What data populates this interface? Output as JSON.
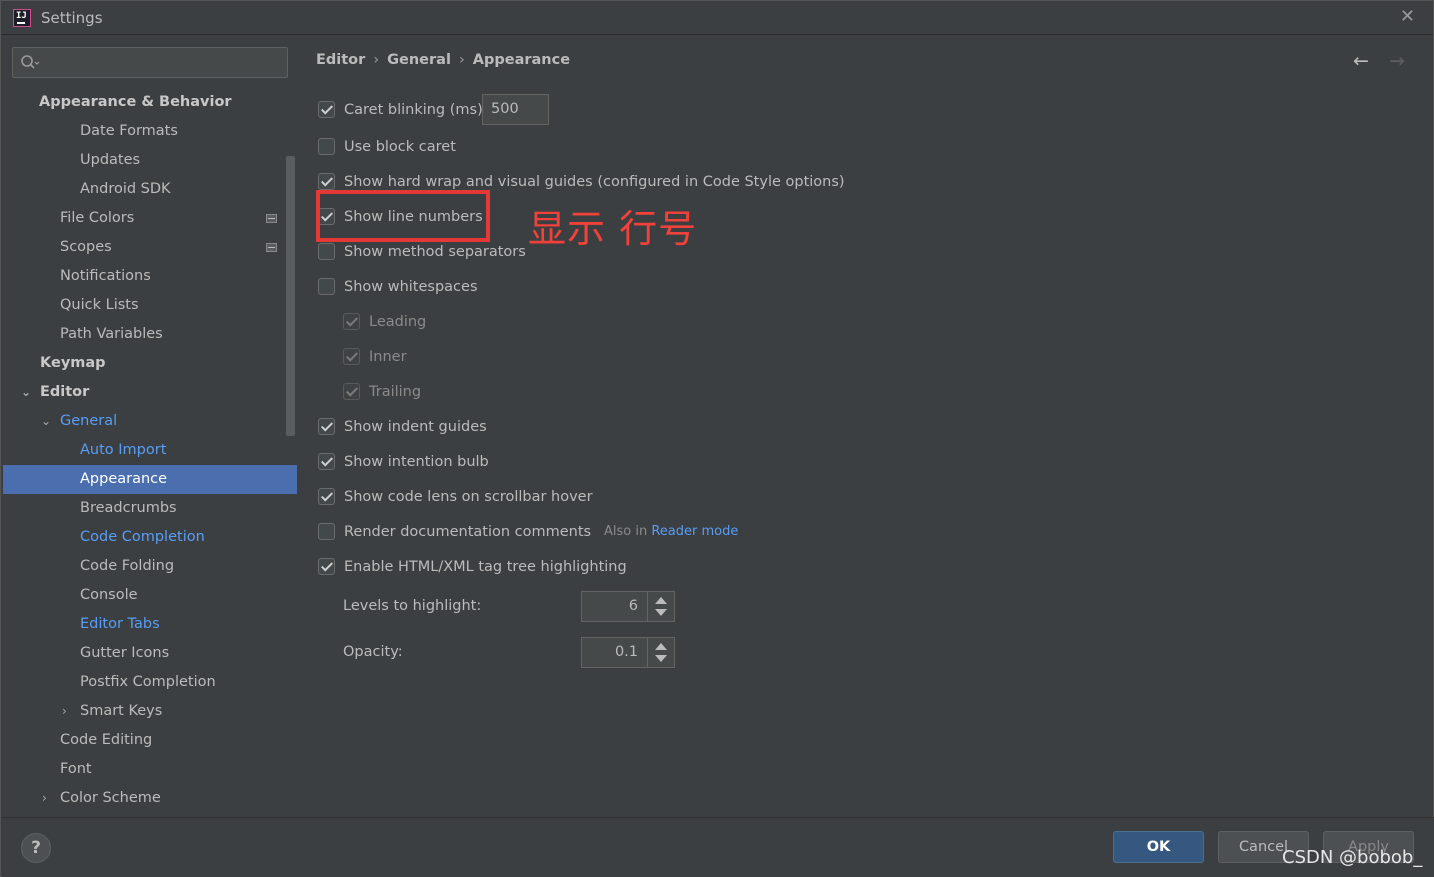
{
  "window": {
    "title": "Settings"
  },
  "search": {
    "placeholder": ""
  },
  "sidebar": {
    "items": [
      {
        "label": "Appearance & Behavior"
      },
      {
        "label": "Date Formats"
      },
      {
        "label": "Updates"
      },
      {
        "label": "Android SDK"
      },
      {
        "label": "File Colors"
      },
      {
        "label": "Scopes"
      },
      {
        "label": "Notifications"
      },
      {
        "label": "Quick Lists"
      },
      {
        "label": "Path Variables"
      },
      {
        "label": "Keymap"
      },
      {
        "label": "Editor"
      },
      {
        "label": "General"
      },
      {
        "label": "Auto Import"
      },
      {
        "label": "Appearance"
      },
      {
        "label": "Breadcrumbs"
      },
      {
        "label": "Code Completion"
      },
      {
        "label": "Code Folding"
      },
      {
        "label": "Console"
      },
      {
        "label": "Editor Tabs"
      },
      {
        "label": "Gutter Icons"
      },
      {
        "label": "Postfix Completion"
      },
      {
        "label": "Smart Keys"
      },
      {
        "label": "Code Editing"
      },
      {
        "label": "Font"
      },
      {
        "label": "Color Scheme"
      }
    ],
    "selected": "Appearance"
  },
  "breadcrumb": {
    "part1": "Editor",
    "part2": "General",
    "part3": "Appearance",
    "separator": "›"
  },
  "nav": {
    "back": "←",
    "forward": "→"
  },
  "options": {
    "caret_blinking": {
      "label": "Caret blinking (ms):",
      "checked": true,
      "value": "500"
    },
    "block_caret": {
      "label": "Use block caret",
      "checked": false
    },
    "hard_wrap": {
      "label": "Show hard wrap and visual guides (configured in Code Style options)",
      "checked": true
    },
    "line_numbers": {
      "label": "Show line numbers",
      "checked": true
    },
    "method_separators": {
      "label": "Show method separators",
      "checked": false
    },
    "whitespaces": {
      "label": "Show whitespaces",
      "checked": false
    },
    "leading": {
      "label": "Leading",
      "checked": true
    },
    "inner": {
      "label": "Inner",
      "checked": true
    },
    "trailing": {
      "label": "Trailing",
      "checked": true
    },
    "indent_guides": {
      "label": "Show indent guides",
      "checked": true
    },
    "intention_bulb": {
      "label": "Show intention bulb",
      "checked": true
    },
    "code_lens": {
      "label": "Show code lens on scrollbar hover",
      "checked": true
    },
    "render_docs": {
      "label": "Render documentation comments",
      "checked": false,
      "hint_prefix": "Also in",
      "hint_link": "Reader mode"
    },
    "tag_tree": {
      "label": "Enable HTML/XML tag tree highlighting",
      "checked": true
    },
    "levels": {
      "label": "Levels to highlight:",
      "value": "6"
    },
    "opacity": {
      "label": "Opacity:",
      "value": "0.1"
    }
  },
  "annotation": {
    "text": "显示 行号"
  },
  "footer": {
    "help": "?",
    "ok": "OK",
    "cancel": "Cancel",
    "apply": "Apply",
    "watermark": "CSDN @bobob_"
  },
  "colors": {
    "background": "#3c3f41",
    "selection": "#4b6eaf",
    "link": "#589df6",
    "ok_button": "#365880",
    "annotation_red": "#e53935"
  }
}
